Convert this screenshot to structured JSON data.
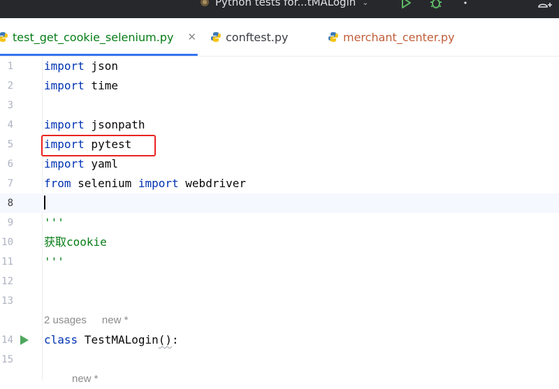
{
  "toolbar": {
    "run_config": "Python tests for...tMALogin",
    "icons": [
      "run-icon",
      "debug-icon",
      "more-icon",
      "add-user-icon"
    ]
  },
  "tabs": [
    {
      "label": "test_get_cookie_selenium.py",
      "active": true,
      "color": "#067d17"
    },
    {
      "label": "conftest.py",
      "active": false,
      "color": "#3b3e45"
    },
    {
      "label": "merchant_center.py",
      "active": false,
      "color": "#c15e3a"
    }
  ],
  "editor": {
    "line_numbers": [
      "1",
      "2",
      "3",
      "4",
      "5",
      "6",
      "7",
      "8",
      "9",
      "10",
      "11",
      "12",
      "13",
      "14",
      "15"
    ],
    "lines": {
      "l1": {
        "kw": "import",
        "rest": " json"
      },
      "l2": {
        "kw": "import",
        "rest": " time"
      },
      "l4": {
        "kw": "import",
        "rest": " jsonpath"
      },
      "l5": {
        "kw": "import",
        "rest": " pytest"
      },
      "l6": {
        "kw": "import",
        "rest": " yaml"
      },
      "l7": {
        "kw1": "from",
        "mid": " selenium ",
        "kw2": "import",
        "rest": " webdriver"
      },
      "l9": {
        "str": "'''"
      },
      "l10": {
        "str": "获取cookie"
      },
      "l11": {
        "str": "'''"
      },
      "l14": {
        "kw": "class",
        "name": " TestMALogin",
        "paren": "()",
        "colon": ":"
      }
    },
    "hint_usages": "2 usages",
    "hint_new": "new *",
    "hint_new_bottom": "new *"
  },
  "colors": {
    "keyword": "#0033b3",
    "string": "#067d17",
    "highlight_box": "#e8231f",
    "tab_underline": "#3574f0"
  }
}
